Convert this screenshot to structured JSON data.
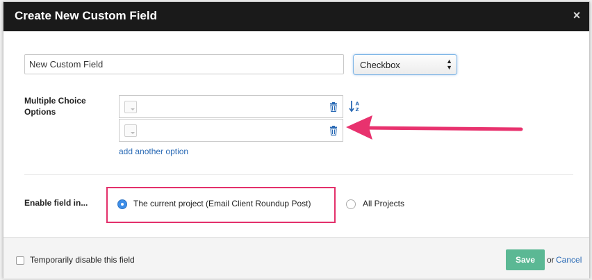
{
  "dialog": {
    "title": "Create New Custom Field",
    "close_icon": "close-icon",
    "close_glyph": "×"
  },
  "field": {
    "name_value": "New Custom Field",
    "type_value": "Checkbox",
    "type_arrows": "▲▼"
  },
  "options": {
    "label": "Multiple Choice Options",
    "rows": [
      {
        "value": "",
        "swatch_icon": "color-swatch-icon",
        "delete_icon": "trash-icon"
      },
      {
        "value": "",
        "swatch_icon": "color-swatch-icon",
        "delete_icon": "trash-icon"
      }
    ],
    "sort_icon": "sort-alpha-icon",
    "add_label": "add another option"
  },
  "enable": {
    "label": "Enable field in...",
    "choices": [
      {
        "label": "The current project (Email Client Roundup Post)",
        "checked": true
      },
      {
        "label": "All Projects",
        "checked": false
      }
    ]
  },
  "footer": {
    "disable_label": "Temporarily disable this field",
    "disable_checked": false,
    "save_label": "Save",
    "or_text": "or",
    "cancel_label": "Cancel"
  },
  "colors": {
    "header_bg": "#1a1a1a",
    "link": "#2a6ab5",
    "save_bg": "#5bb894",
    "radio_checked": "#3e8ee8",
    "annotation": "#e3306b"
  }
}
